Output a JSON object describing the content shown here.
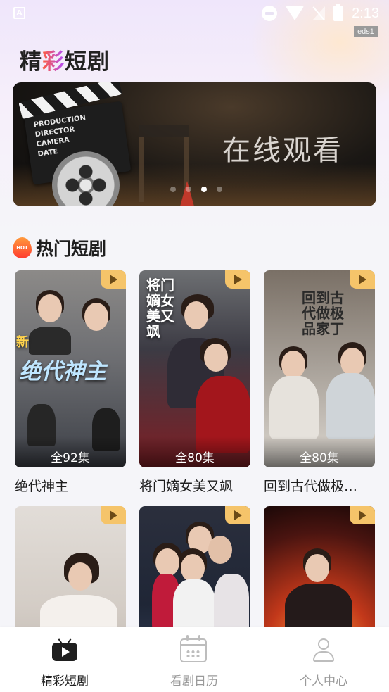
{
  "status_bar": {
    "time": "2:13",
    "badge": "eds1"
  },
  "app": {
    "title_prefix": "精",
    "title_accent": "彩",
    "title_suffix": "短剧"
  },
  "banner": {
    "text": "在线观看",
    "clapper_lines": [
      "PRODUCTION",
      "DIRECTOR",
      "CAMERA",
      "DATE"
    ],
    "slides_total": 4,
    "active_slide": 3
  },
  "section": {
    "title": "热门短剧",
    "hot_badge": "HOT"
  },
  "dramas": [
    {
      "title": "绝代神主",
      "episodes": "全92集",
      "poster_text": "绝代神主",
      "poster_tag": "新"
    },
    {
      "title": "将门嫡女美又飒",
      "episodes": "全80集",
      "poster_text": "将门嫡女美又飒"
    },
    {
      "title": "回到古代做极…",
      "episodes": "全80集",
      "poster_text": "回到古代做极品家丁"
    },
    {
      "title": "",
      "episodes": ""
    },
    {
      "title": "",
      "episodes": ""
    },
    {
      "title": "",
      "episodes": ""
    }
  ],
  "bottom_nav": {
    "items": [
      {
        "label": "精彩短剧",
        "icon": "tv-play-icon",
        "active": true
      },
      {
        "label": "看剧日历",
        "icon": "calendar-icon",
        "active": false
      },
      {
        "label": "个人中心",
        "icon": "user-icon",
        "active": false
      }
    ]
  },
  "colors": {
    "accent_gold": "#f5c46a",
    "hot_red": "#ff3b2f",
    "text_dark": "#1e1e1e",
    "nav_inactive": "#9a9a9a"
  }
}
